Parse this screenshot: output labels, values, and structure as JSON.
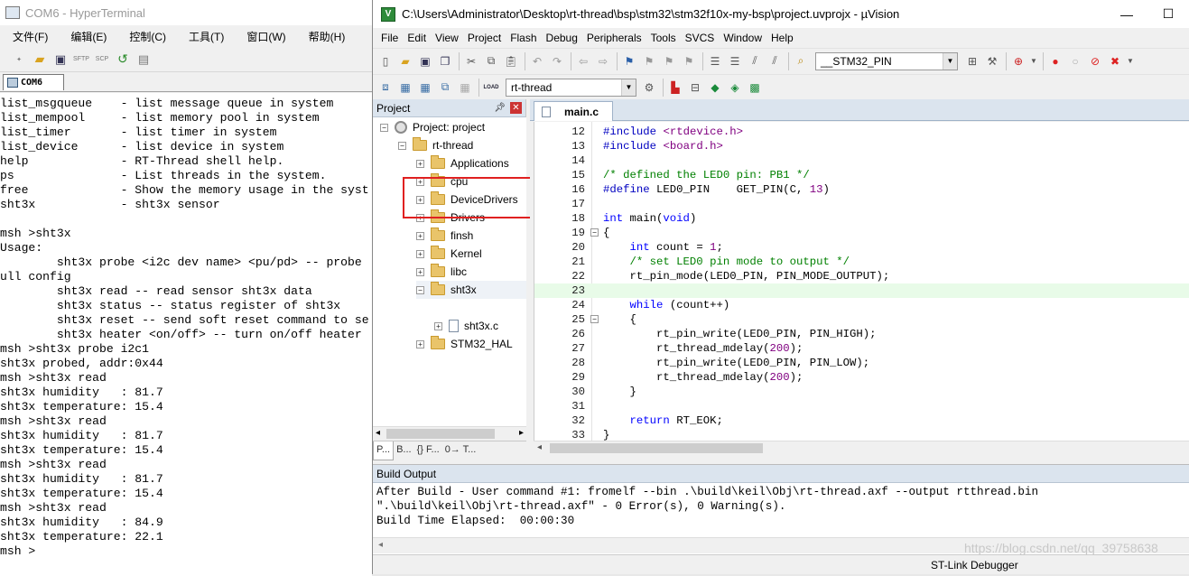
{
  "hyperterminal": {
    "title": "COM6 - HyperTerminal",
    "menu": [
      "文件(F)",
      "编辑(E)",
      "控制(C)",
      "工具(T)",
      "窗口(W)",
      "帮助(H)"
    ],
    "toolbar_labels": {
      "sftp": "SFTP",
      "scp": "SCP"
    },
    "tab_label": "COM6",
    "terminal_lines": [
      "list_msgqueue    - list message queue in system",
      "list_mempool     - list memory pool in system",
      "list_timer       - list timer in system",
      "list_device      - list device in system",
      "help             - RT-Thread shell help.",
      "ps               - List threads in the system.",
      "free             - Show the memory usage in the syst",
      "sht3x            - sht3x sensor",
      "",
      "msh >sht3x",
      "Usage:",
      "        sht3x probe <i2c dev name> <pu/pd> -- probe",
      "ull config",
      "        sht3x read -- read sensor sht3x data",
      "        sht3x status -- status register of sht3x",
      "        sht3x reset -- send soft reset command to se",
      "        sht3x heater <on/off> -- turn on/off heater",
      "msh >sht3x probe i2c1",
      "sht3x probed, addr:0x44",
      "msh >sht3x read",
      "sht3x humidity   : 81.7",
      "sht3x temperature: 15.4",
      "msh >sht3x read",
      "sht3x humidity   : 81.7",
      "sht3x temperature: 15.4",
      "msh >sht3x read",
      "sht3x humidity   : 81.7",
      "sht3x temperature: 15.4",
      "msh >sht3x read",
      "sht3x humidity   : 84.9",
      "sht3x temperature: 22.1",
      "msh >"
    ]
  },
  "uvision": {
    "title": "C:\\Users\\Administrator\\Desktop\\rt-thread\\bsp\\stm32\\stm32f10x-my-bsp\\project.uvprojx - µVision",
    "menu": [
      "File",
      "Edit",
      "View",
      "Project",
      "Flash",
      "Debug",
      "Peripherals",
      "Tools",
      "SVCS",
      "Window",
      "Help"
    ],
    "toolbar": {
      "find_combo": "__STM32_PIN",
      "target_combo": "rt-thread",
      "load_label": "LOAD"
    },
    "project_panel": {
      "title": "Project",
      "root": "Project: project",
      "target": "rt-thread",
      "groups": [
        "Applications",
        "cpu",
        "DeviceDrivers",
        "Drivers",
        "finsh",
        "Kernel",
        "libc",
        "sht3x"
      ],
      "sht3x_file": "sht3x.c",
      "last_group": "STM32_HAL",
      "tabs": [
        "P...",
        "B...",
        "{} F...",
        "0→ T..."
      ]
    },
    "editor": {
      "tab": "main.c",
      "lines": [
        {
          "n": "12",
          "t": "#include <rtdevice.h>"
        },
        {
          "n": "13",
          "t": "#include <board.h>"
        },
        {
          "n": "14",
          "t": ""
        },
        {
          "n": "15",
          "t": "/* defined the LED0 pin: PB1 */"
        },
        {
          "n": "16",
          "t": "#define LED0_PIN    GET_PIN(C, 13)"
        },
        {
          "n": "17",
          "t": ""
        },
        {
          "n": "18",
          "t": "int main(void)"
        },
        {
          "n": "19",
          "t": "{"
        },
        {
          "n": "20",
          "t": "    int count = 1;"
        },
        {
          "n": "21",
          "t": "    /* set LED0 pin mode to output */"
        },
        {
          "n": "22",
          "t": "    rt_pin_mode(LED0_PIN, PIN_MODE_OUTPUT);"
        },
        {
          "n": "23",
          "t": ""
        },
        {
          "n": "24",
          "t": "    while (count++)"
        },
        {
          "n": "25",
          "t": "    {"
        },
        {
          "n": "26",
          "t": "        rt_pin_write(LED0_PIN, PIN_HIGH);"
        },
        {
          "n": "27",
          "t": "        rt_thread_mdelay(200);"
        },
        {
          "n": "28",
          "t": "        rt_pin_write(LED0_PIN, PIN_LOW);"
        },
        {
          "n": "29",
          "t": "        rt_thread_mdelay(200);"
        },
        {
          "n": "30",
          "t": "    }"
        },
        {
          "n": "31",
          "t": ""
        },
        {
          "n": "32",
          "t": "    return RT_EOK;"
        },
        {
          "n": "33",
          "t": "}"
        }
      ]
    },
    "build_output": {
      "title": "Build Output",
      "lines": [
        "After Build - User command #1: fromelf --bin .\\build\\keil\\Obj\\rt-thread.axf --output rtthread.bin",
        "\".\\build\\keil\\Obj\\rt-thread.axf\" - 0 Error(s), 0 Warning(s).",
        "Build Time Elapsed:  00:00:30"
      ]
    },
    "status": "ST-Link Debugger",
    "watermark": "https://blog.csdn.net/qq_39758638"
  },
  "colors": {
    "highlight_box": "#e02020",
    "current_line": "#e8fbe8",
    "panel_header": "#dbe4ee"
  }
}
